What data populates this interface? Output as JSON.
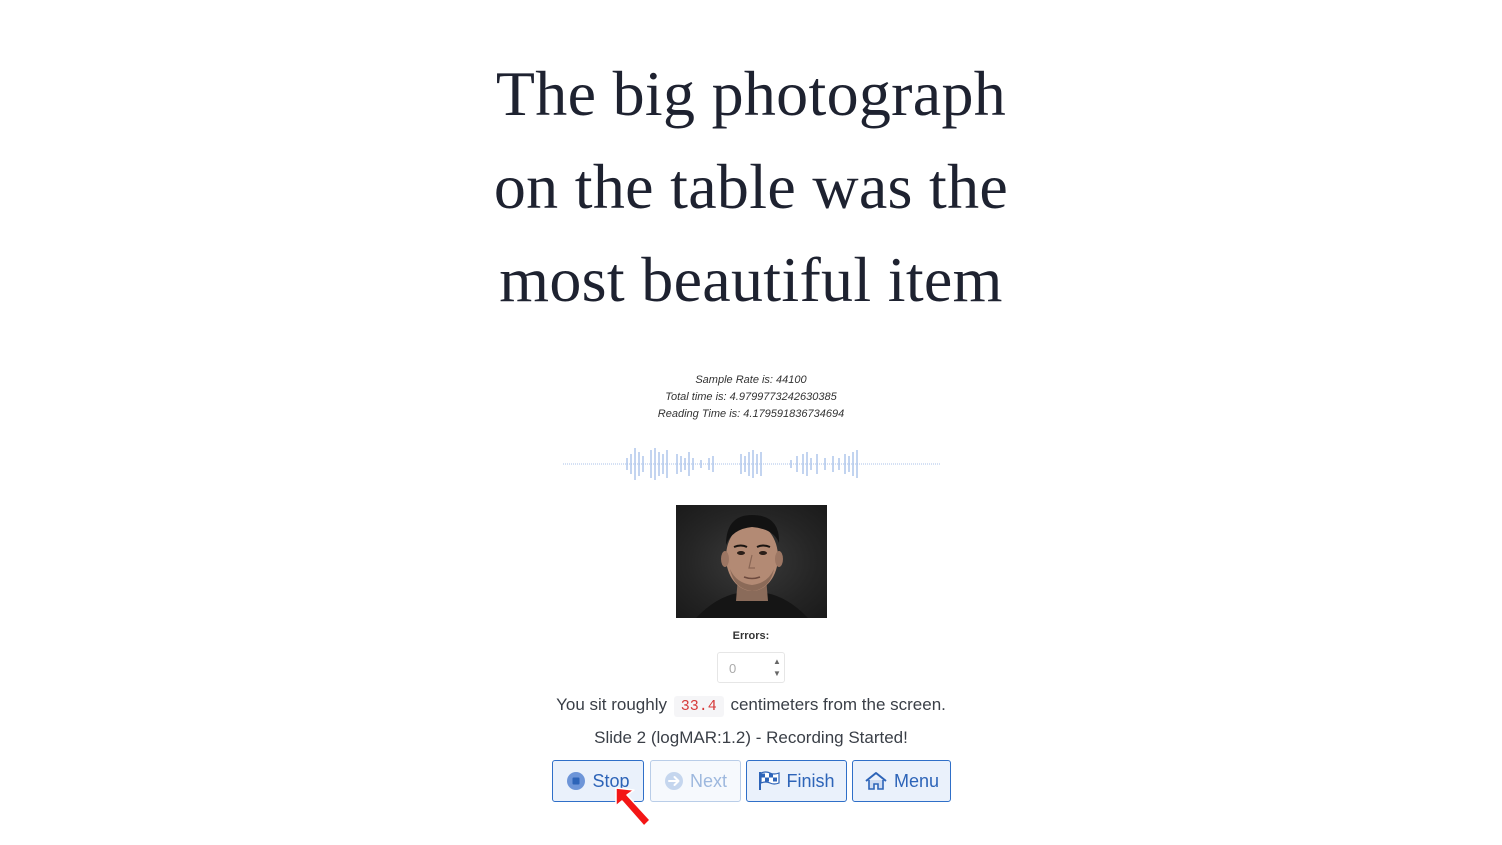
{
  "reading": {
    "lines": [
      "The big photograph",
      "on the table was the",
      "most beautiful item"
    ]
  },
  "stats": {
    "sample_rate": "Sample Rate is: 44100",
    "total_time": "Total time is: 4.9799773242630385",
    "reading_time": "Reading Time is: 4.179591836734694"
  },
  "errors": {
    "label": "Errors:",
    "value": "0"
  },
  "distance": {
    "prefix": "You sit roughly",
    "value": "33.4",
    "suffix": "centimeters from the screen."
  },
  "status": {
    "text_1": "Slide ",
    "slide": "2",
    "text_2": " (logMAR:",
    "logmar": "1.2",
    "text_3": ") - Recording Started!"
  },
  "buttons": {
    "stop": "Stop",
    "next": "Next",
    "finish": "Finish",
    "menu": "Menu"
  },
  "colors": {
    "accent": "#2d64b8",
    "waveform": "#a9c2ea",
    "distance_value": "#d63a3a"
  }
}
